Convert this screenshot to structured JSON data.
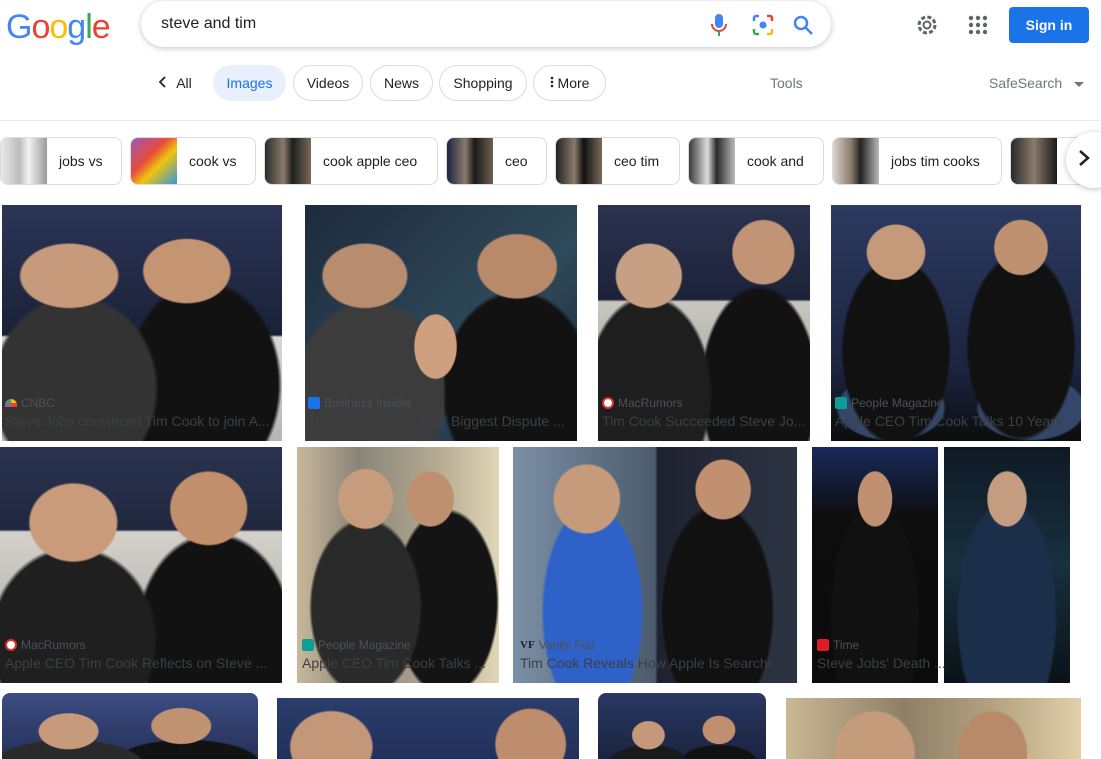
{
  "search": {
    "query": "steve and tim"
  },
  "header": {
    "sign_in_label": "Sign in",
    "logo_text": "Google"
  },
  "tabs": [
    {
      "label": "All"
    },
    {
      "label": "Images"
    },
    {
      "label": "Videos"
    },
    {
      "label": "News"
    },
    {
      "label": "Shopping"
    },
    {
      "label": "More"
    }
  ],
  "tools_label": "Tools",
  "safesearch_label": "SafeSearch",
  "chips": [
    {
      "label": "jobs vs"
    },
    {
      "label": "cook vs"
    },
    {
      "label": "cook apple ceo"
    },
    {
      "label": "ceo"
    },
    {
      "label": "ceo tim"
    },
    {
      "label": "cook and"
    },
    {
      "label": "jobs tim cooks"
    }
  ],
  "results": [
    {
      "source": "CNBC",
      "caption": "Steve Jobs convinced Tim Cook to join A..."
    },
    {
      "source": "Business Insider",
      "caption": "Tim Cook, Steve Jobs' Biggest Dispute ..."
    },
    {
      "source": "MacRumors",
      "caption": "Tim Cook Succeeded Steve Jo..."
    },
    {
      "source": "People Magazine",
      "caption": "Apple CEO Tim Cook Talks 10 Years..."
    },
    {
      "source": "MacRumors",
      "caption": "Apple CEO Tim Cook Reflects on Steve ..."
    },
    {
      "source": "People Magazine",
      "caption": "Apple CEO Tim Cook Talks ..."
    },
    {
      "source": "Vanity Fair",
      "caption": "Tim Cook Reveals How Apple Is Searchi..."
    },
    {
      "source": "Time",
      "caption": "Steve Jobs' Death ..."
    }
  ],
  "colors": {
    "accent": "#1a73e8",
    "active_tab_bg": "#e8f0fe"
  }
}
